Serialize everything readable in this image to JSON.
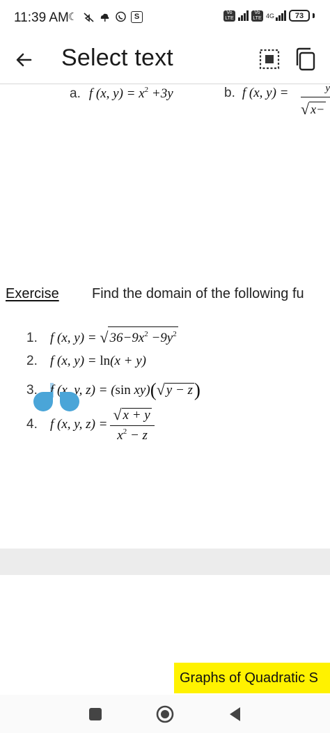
{
  "status_bar": {
    "time": "11:39 AM",
    "left_icons": [
      "moon-icon",
      "mute-icon",
      "cloud-icon",
      "viber-icon",
      "s-app-icon"
    ],
    "s_app_letter": "S",
    "volte_label": "Vo LTE",
    "network_type": "4G",
    "battery_level": "73"
  },
  "app_bar": {
    "title": "Select text"
  },
  "document": {
    "row_a": {
      "label": "a.",
      "expr_lhs": "f (x, y) = x",
      "expr_exp": "2",
      "expr_rhs": " +3y"
    },
    "row_b": {
      "label": "b.",
      "expr_lhs": "f (x, y) =",
      "frac_num": "y",
      "frac_den": "x−"
    },
    "exercise": {
      "title": "Exercise",
      "text": "Find the domain of the following fu"
    },
    "items": [
      {
        "label": "1.",
        "lhs": "f (x, y) = ",
        "sqrt_a": "36−9x",
        "sup1": "2",
        "sqrt_b": " −9y",
        "sup2": "2"
      },
      {
        "label": "2.",
        "lhs": "f (x, y) = ",
        "ln": "ln",
        "rhs": "(x + y)"
      },
      {
        "label": "3.",
        "f": "f",
        "lhs": " (x, y, z) = (",
        "sin": "sin",
        "xy": " xy)",
        "sqrt": "y − z"
      },
      {
        "label": "4.",
        "lhs": "f (x, y, z) =",
        "num": "x + y",
        "den_a": "x",
        "den_sup": "2",
        "den_b": " − z"
      }
    ]
  },
  "footer": {
    "chip_text": "Graphs of Quadratic S"
  },
  "colors": {
    "selection": "#a7d2ef",
    "handle": "#4aa5d8",
    "footer_chip": "#fff200",
    "gray_band": "#ececec"
  }
}
